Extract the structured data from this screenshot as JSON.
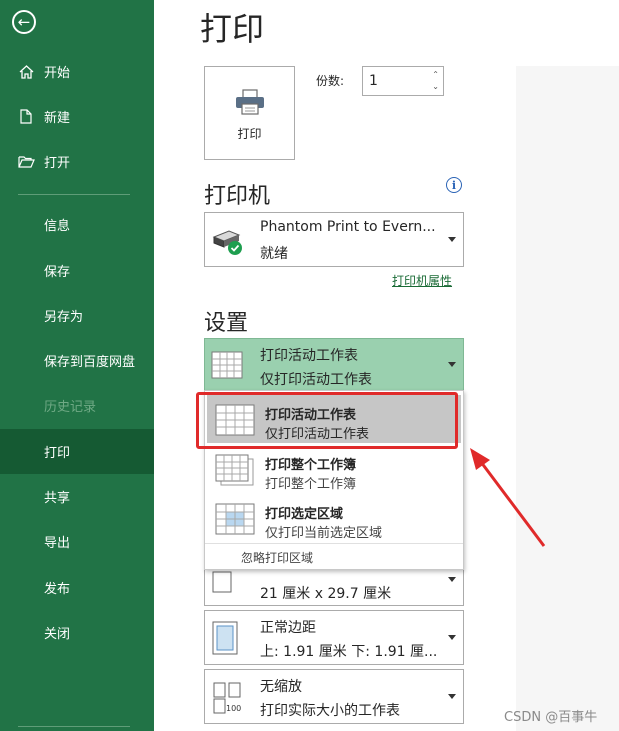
{
  "sidebar": {
    "items": [
      {
        "label": "开始",
        "icon": "home-icon"
      },
      {
        "label": "新建",
        "icon": "new-document-icon"
      },
      {
        "label": "打开",
        "icon": "open-folder-icon"
      },
      {
        "label": "信息"
      },
      {
        "label": "保存"
      },
      {
        "label": "另存为"
      },
      {
        "label": "保存到百度网盘"
      },
      {
        "label": "历史记录",
        "state": "disabled"
      },
      {
        "label": "打印",
        "state": "active"
      },
      {
        "label": "共享"
      },
      {
        "label": "导出"
      },
      {
        "label": "发布"
      },
      {
        "label": "关闭"
      }
    ]
  },
  "page": {
    "title": "打印"
  },
  "print": {
    "button_label": "打印",
    "copies_label": "份数:",
    "copies_value": "1"
  },
  "printer": {
    "heading": "打印机",
    "name": "Phantom Print to Evern...",
    "status": "就绪",
    "properties_link": "打印机属性"
  },
  "settings": {
    "heading": "设置",
    "scope": {
      "title": "打印活动工作表",
      "subtitle": "仅打印活动工作表"
    },
    "menu": {
      "items": [
        {
          "title": "打印活动工作表",
          "subtitle": "仅打印活动工作表",
          "highlighted": true
        },
        {
          "title": "打印整个工作簿",
          "subtitle": "打印整个工作簿"
        },
        {
          "title": "打印选定区域",
          "subtitle": "仅打印当前选定区域"
        }
      ],
      "ignore_label": "忽略打印区域"
    },
    "paper": {
      "subtitle": "21 厘米 x 29.7 厘米"
    },
    "margins": {
      "title": "正常边距",
      "subtitle": "上: 1.91 厘米 下: 1.91 厘..."
    },
    "scaling": {
      "title": "无缩放",
      "subtitle": "打印实际大小的工作表"
    }
  },
  "watermark": "CSDN @百事牛",
  "colors": {
    "sidebar": "#217346",
    "active_nav": "#155a33",
    "selected_dropdown": "#9ad0af",
    "annotation": "#e02a2a"
  }
}
